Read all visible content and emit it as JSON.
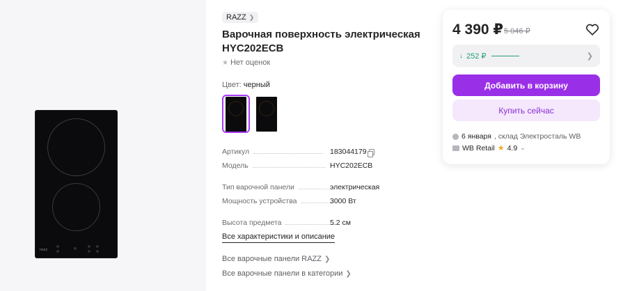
{
  "product": {
    "brand": "RAZZ",
    "title": "Варочная поверхность электрическая HYC202ECB",
    "rating_text": "Нет оценок",
    "image_logo_text": "razz"
  },
  "color": {
    "label": "Цвет:",
    "value": "черный"
  },
  "specs": [
    {
      "key": "Артикул",
      "value": "183044179"
    },
    {
      "key": "Модель",
      "value": "HYC202ECB"
    },
    {
      "key": "Тип варочной панели",
      "value": "электрическая"
    },
    {
      "key": "Мощность устройства",
      "value": "3000 Вт"
    },
    {
      "key": "Высота предмета",
      "value": "5.2 см"
    }
  ],
  "links": {
    "all_characteristics": "Все характеристики и описание",
    "brand_panels": "Все варочные панели RAZZ",
    "category_panels": "Все варочные панели в категории"
  },
  "card": {
    "price": "4 390 ₽",
    "old_price": "5 046 ₽",
    "wallet_discount": "252 ₽",
    "add_to_cart": "Добавить в корзину",
    "buy_now": "Купить сейчас",
    "delivery_date": "6 января",
    "delivery_warehouse": ", склад Электросталь WB",
    "seller": "WB Retail",
    "seller_rating": "4.9"
  },
  "colors": {
    "accent": "#9a2fe8",
    "accent_light": "#f5e8fd",
    "wallet_green": "#23a26d"
  },
  "icons": {
    "heart": "heart-icon",
    "copy": "copy-icon",
    "star": "star-icon",
    "chevron": "chevron-right-icon"
  }
}
